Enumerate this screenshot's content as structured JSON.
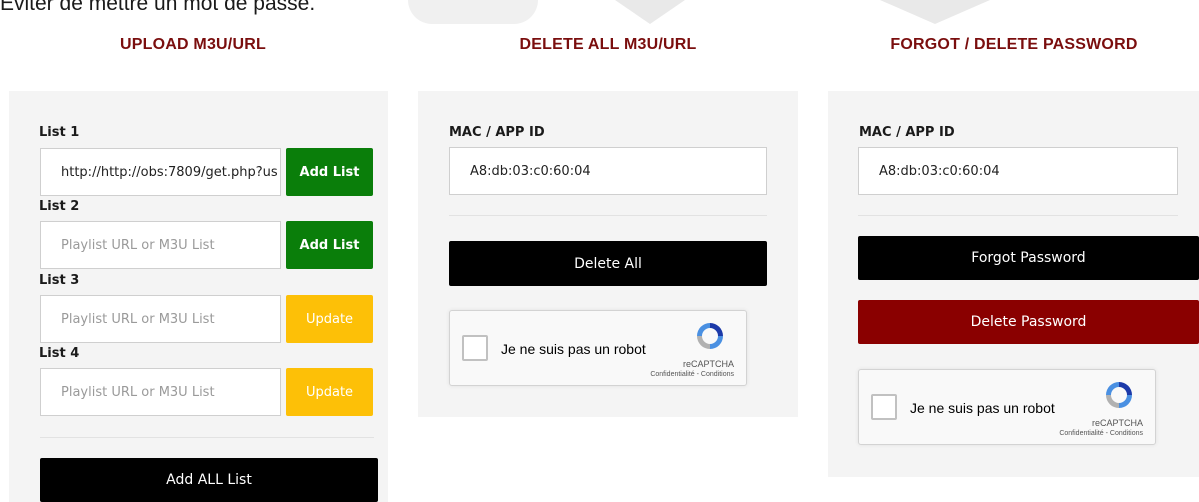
{
  "intro_text": "Eviter de mettre un mot de passe.",
  "upload": {
    "title": "UPLOAD M3U/URL",
    "lists": [
      {
        "label": "List 1",
        "value": "http://http://obs:7809/get.php?us",
        "placeholder": "",
        "button": "Add List",
        "button_color": "#0a7e0a"
      },
      {
        "label": "List 2",
        "value": "",
        "placeholder": "Playlist URL or M3U List",
        "button": "Add List",
        "button_color": "#0a7e0a"
      },
      {
        "label": "List 3",
        "value": "",
        "placeholder": "Playlist URL or M3U List",
        "button": "Update",
        "button_color": "#fdc007"
      },
      {
        "label": "List 4",
        "value": "",
        "placeholder": "Playlist URL or M3U List",
        "button": "Update",
        "button_color": "#fdc007"
      }
    ],
    "add_all_label": "Add ALL List"
  },
  "delete": {
    "title": "DELETE ALL M3U/URL",
    "mac_label": "MAC / APP ID",
    "mac_value": "A8:db:03:c0:60:04",
    "delete_all_label": "Delete All",
    "captcha": {
      "text": "Je ne suis pas un robot",
      "brand": "reCAPTCHA",
      "links": "Confidentialité - Conditions"
    }
  },
  "forgot": {
    "title": "FORGOT / DELETE PASSWORD",
    "mac_label": "MAC / APP ID",
    "mac_value": "A8:db:03:c0:60:04",
    "forgot_label": "Forgot Password",
    "delete_label": "Delete Password",
    "captcha": {
      "text": "Je ne suis pas un robot",
      "brand": "reCAPTCHA",
      "links": "Confidentialité - Conditions"
    }
  },
  "colors": {
    "title": "#7a0e0e",
    "green": "#0a7e0a",
    "yellow": "#fdc007",
    "dark_red": "#8a0000"
  }
}
